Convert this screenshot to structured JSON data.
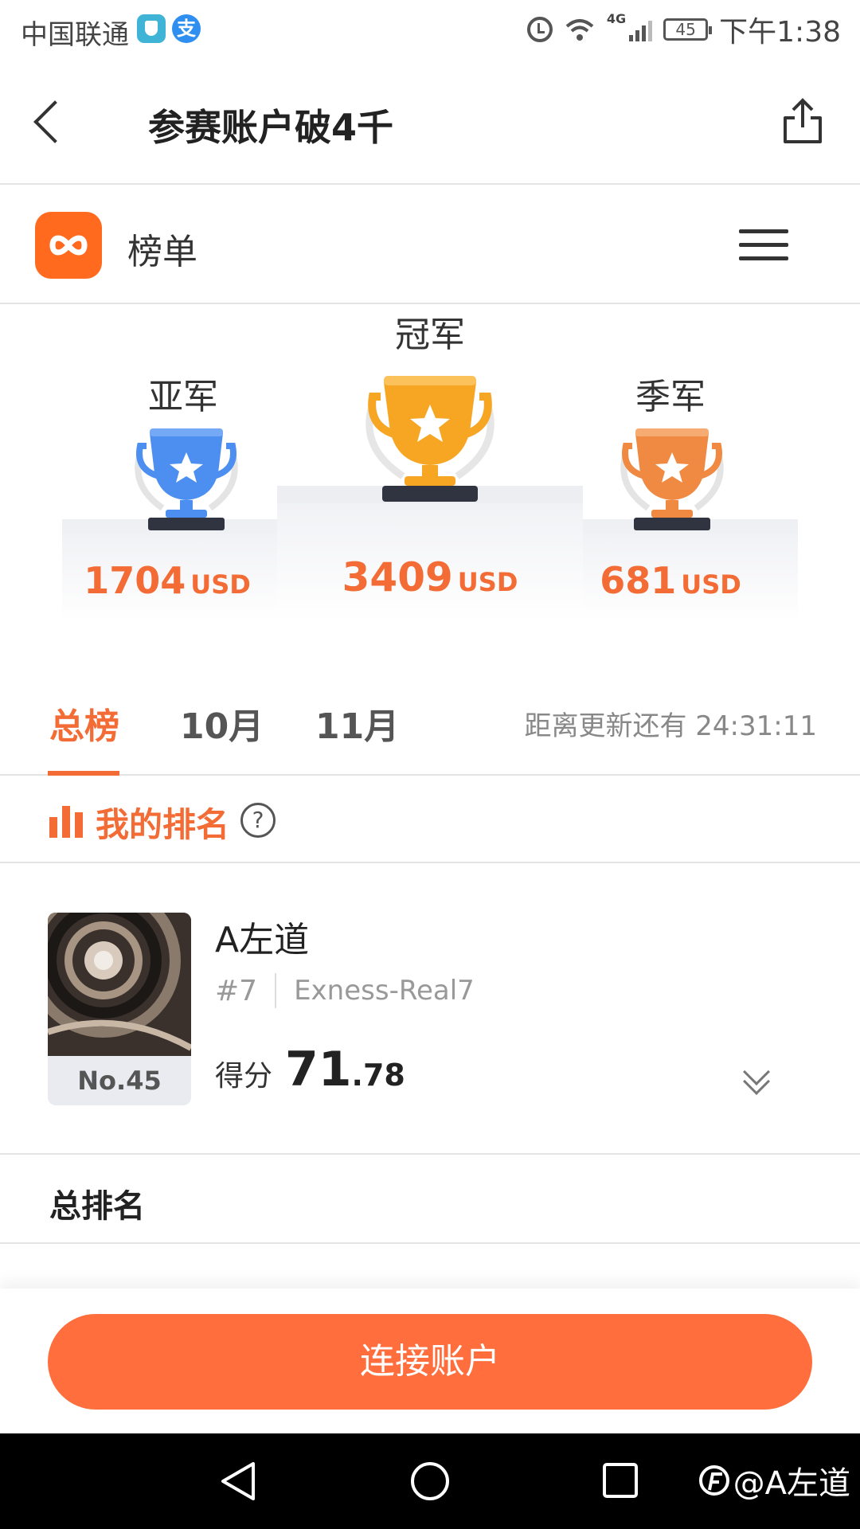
{
  "status_bar": {
    "carrier": "中国联通",
    "alipay_glyph": "支",
    "network": "4G",
    "battery": "45",
    "time": "下午1:38"
  },
  "header": {
    "title": "参赛账户破4千"
  },
  "app": {
    "title": "榜单",
    "accent_color": "#f36c36"
  },
  "podium": {
    "first": {
      "label": "冠军",
      "amount": "3409",
      "currency": "USD",
      "trophy_color": "#f7a623"
    },
    "second": {
      "label": "亚军",
      "amount": "1704",
      "currency": "USD",
      "trophy_color": "#4c8ff0"
    },
    "third": {
      "label": "季军",
      "amount": "681",
      "currency": "USD",
      "trophy_color": "#f08a42"
    }
  },
  "tabs": {
    "items": [
      "总榜",
      "10月",
      "11月"
    ],
    "active_index": 0,
    "countdown": "距离更新还有 24:31:11"
  },
  "my_ranking": {
    "title": "我的排名",
    "help_glyph": "?",
    "rank_no": "No.45",
    "name": "A左道",
    "position": "#7",
    "account": "Exness-Real7",
    "score_label": "得分",
    "score_int": "71",
    "score_dec": ".78"
  },
  "total_ranking": {
    "title": "总排名"
  },
  "connect_button": {
    "label": "连接账户"
  },
  "watermark": {
    "text": "@A左道"
  }
}
